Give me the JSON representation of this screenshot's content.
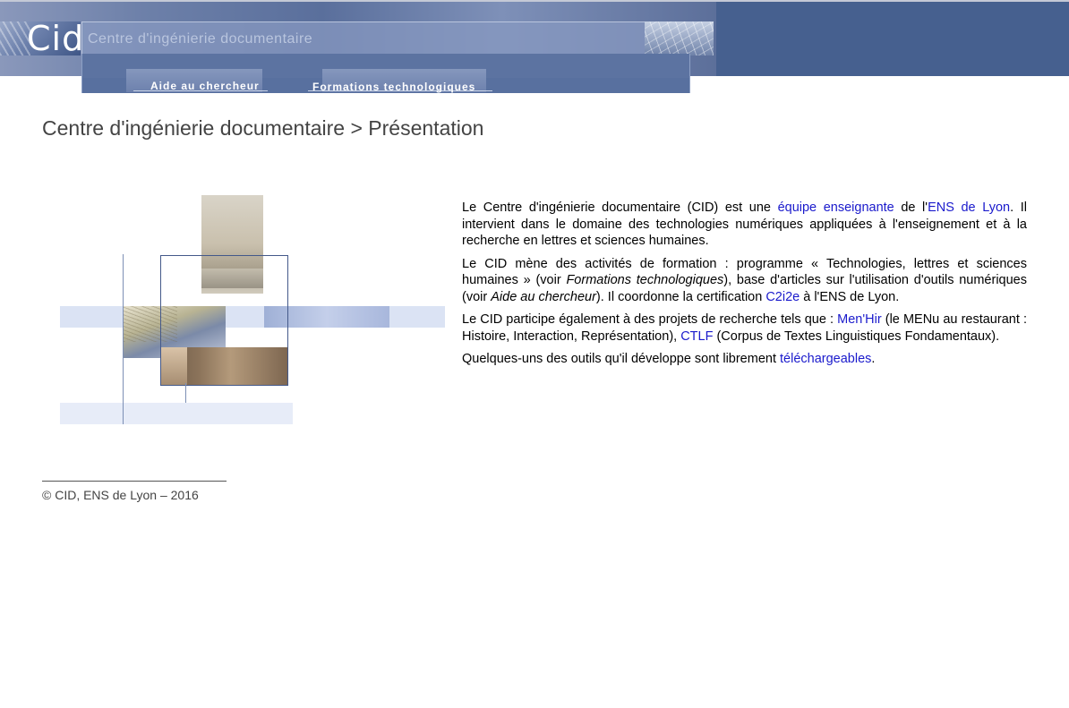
{
  "header": {
    "logo_text": "Cid",
    "site_title": "Centre d'ingénierie documentaire",
    "nav": [
      {
        "label": "Aide au chercheur"
      },
      {
        "label": "Formations technologiques"
      }
    ]
  },
  "page": {
    "title": "Centre d'ingénierie documentaire > Présentation"
  },
  "content": {
    "p1": {
      "t1": "Le Centre d'ingénierie documentaire (CID) est une ",
      "link1": "équipe enseignante",
      "t2": " de l'",
      "link2": "ENS de Lyon",
      "t3": ". Il intervient dans le domaine des technologies numériques appliquées à l'enseignement et à la recherche en lettres et sciences humaines."
    },
    "p2": {
      "t1": "Le CID mène des activités de formation : programme « Technologies, lettres et sciences humaines » (voir ",
      "em1": "Formations technologiques",
      "t2": "), base d'articles sur l'utilisation d'outils numériques (voir ",
      "em2": "Aide au chercheur",
      "t3": "). Il coordonne la certification ",
      "link1": "C2i2e",
      "t4": " à l'ENS de Lyon."
    },
    "p3": {
      "t1": "Le CID participe également à des projets de recherche tels que : ",
      "link1": "Men'Hir",
      "t2": " (le MENu au restaurant : Histoire, Interaction, Représentation), ",
      "link2": "CTLF",
      "t3": " (Corpus de Textes Linguistiques Fondamentaux)."
    },
    "p4": {
      "t1": "Quelques-uns des outils qu'il développe sont librement ",
      "link1": "téléchargeables",
      "t2": "."
    }
  },
  "footer": {
    "copyright": "© CID, ENS de Lyon – 2016"
  },
  "colors": {
    "banner": "#46608f",
    "link": "#1a1acc",
    "title": "#444444"
  }
}
